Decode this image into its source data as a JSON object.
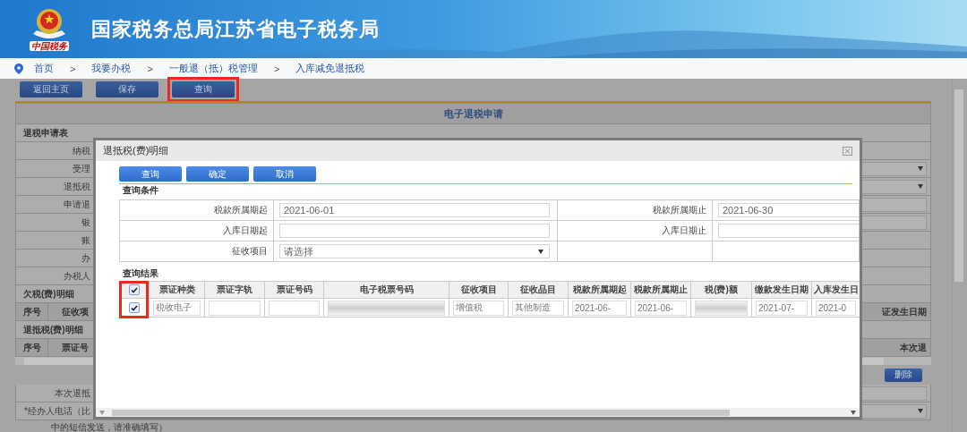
{
  "header": {
    "title": "国家税务总局江苏省电子税务局",
    "logo_caption": "中国税务"
  },
  "breadcrumb": [
    {
      "label": "首页",
      "sep": ">"
    },
    {
      "label": "我要办税",
      "sep": ">"
    },
    {
      "label": "一般退（抵）税管理",
      "sep": ">"
    },
    {
      "label": "入库减免退抵税"
    }
  ],
  "toolbar": [
    {
      "label": "返回主页",
      "highlighted": false
    },
    {
      "label": "保存",
      "highlighted": false
    },
    {
      "label": "查询",
      "highlighted": true
    }
  ],
  "form": {
    "title": "电子退税申请",
    "section": "退税申请表",
    "rows": [
      {
        "label": "纳税",
        "kind": "text"
      },
      {
        "label": "受理",
        "kind": "select"
      },
      {
        "label": "退抵税",
        "kind": "select"
      },
      {
        "label": "申请退",
        "kind": "input"
      },
      {
        "label": "银",
        "kind": "input"
      },
      {
        "label": "账",
        "kind": "text"
      },
      {
        "label": "办",
        "kind": "text"
      },
      {
        "label": "办税人",
        "kind": "text"
      }
    ],
    "arrears": {
      "title": "欠税(费)明细",
      "columns": [
        "序号",
        "征收项"
      ],
      "right_header": "证发生日期"
    },
    "refund": {
      "title": "退抵税(费)明细",
      "columns": [
        "序号",
        "票证号"
      ],
      "right_header": "本次退"
    },
    "delete_button": "删除",
    "bottom_rows": [
      {
        "label": "本次退抵",
        "kind": "input"
      },
      {
        "label": "*经办人电话（比",
        "kind": "select"
      }
    ],
    "note": "中的短信发送，请准确填写）"
  },
  "dialog": {
    "title": "退抵税(费)明细",
    "buttons": [
      "查询",
      "确定",
      "取消"
    ],
    "criteria_title": "查询条件",
    "criteria": [
      {
        "label": "税款所属期起",
        "kind": "input",
        "value": "2021-06-01"
      },
      {
        "label": "税款所属期止",
        "kind": "input",
        "value": "2021-06-30"
      },
      {
        "label": "入库日期起",
        "kind": "input"
      },
      {
        "label": "入库日期止",
        "kind": "input"
      },
      {
        "label": "征收项目",
        "kind": "select",
        "value": "请选择"
      },
      {
        "kind": "empty"
      }
    ],
    "results_title": "查询结果",
    "results": {
      "checkbox_highlighted": true,
      "all_checked": true,
      "columns": [
        "票证种类",
        "票证字轨",
        "票证号码",
        "电子税票号码",
        "征收项目",
        "征收品目",
        "税款所属期起",
        "税款所属期止",
        "税(费)额",
        "缴款发生日期",
        "入库发生日"
      ],
      "rows": [
        {
          "checked": true,
          "cells": [
            {
              "kind": "input",
              "value": "税收电子"
            },
            {
              "kind": "input"
            },
            {
              "kind": "input"
            },
            {
              "kind": "redacted"
            },
            {
              "kind": "input",
              "value": "增值税"
            },
            {
              "kind": "input",
              "value": "其他制造"
            },
            {
              "kind": "input",
              "value": "2021-06-"
            },
            {
              "kind": "input",
              "value": "2021-06-"
            },
            {
              "kind": "redacted"
            },
            {
              "kind": "input",
              "value": "2021-07-"
            },
            {
              "kind": "input",
              "value": "2021-0"
            }
          ]
        }
      ]
    }
  }
}
